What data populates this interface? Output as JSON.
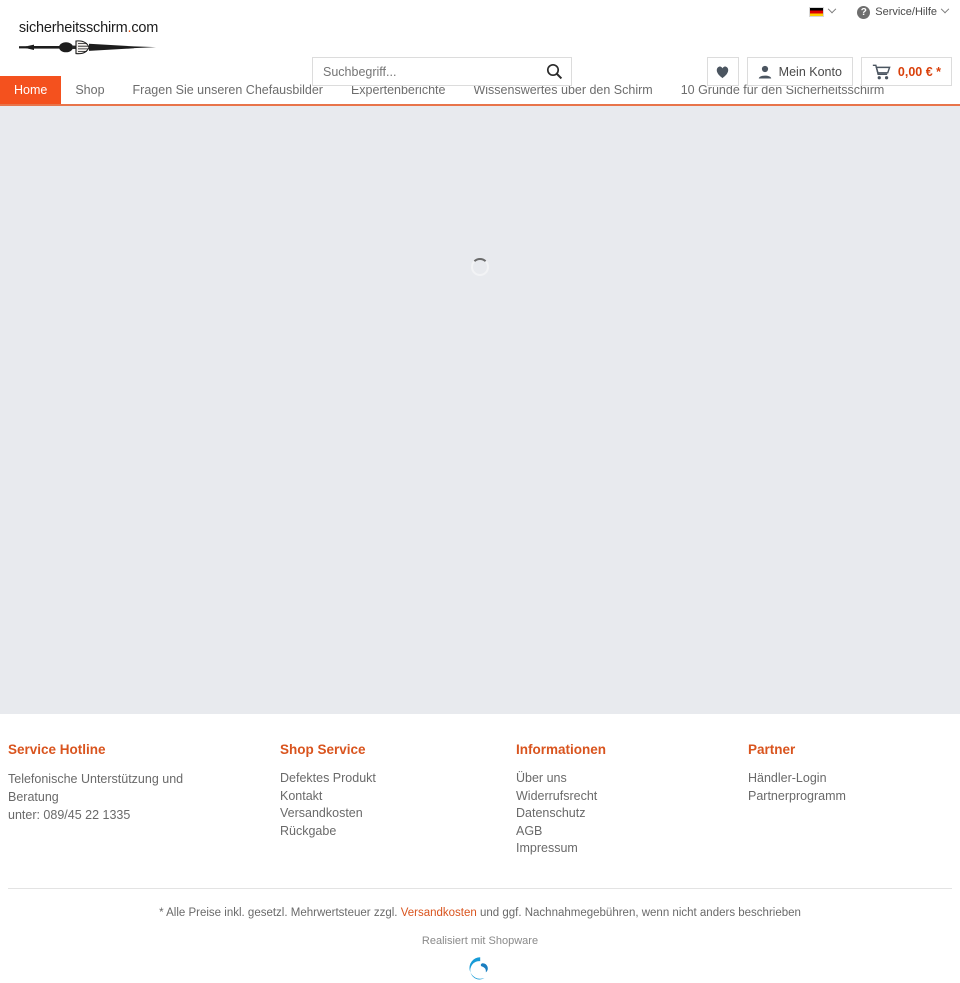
{
  "topbar": {
    "language": {
      "icon": "german-flag-icon",
      "label": "",
      "chevron": "chevron-down-icon"
    },
    "service": {
      "icon": "question-circle-icon",
      "label": "Service/Hilfe",
      "chevron": "chevron-down-icon"
    }
  },
  "header": {
    "logo": {
      "text": "sicherheitsschirm",
      "dot": ".",
      "tld": "com",
      "art": "umbrella-fist-icon"
    },
    "search": {
      "placeholder": "Suchbegriff...",
      "value": "",
      "button_icon": "search-icon"
    },
    "actions": {
      "wishlist": {
        "icon": "heart-icon",
        "label": ""
      },
      "account": {
        "icon": "user-icon",
        "label": "Mein Konto"
      },
      "cart": {
        "icon": "cart-icon",
        "label": "0,00 € *"
      }
    }
  },
  "nav": {
    "items": [
      {
        "label": "Home",
        "active": true
      },
      {
        "label": "Shop",
        "active": false
      },
      {
        "label": "Fragen Sie unseren Chefausbilder",
        "active": false
      },
      {
        "label": "Expertenberichte",
        "active": false
      },
      {
        "label": "Wissenswertes über den Schirm",
        "active": false
      },
      {
        "label": "10 Gründe für den Sicherheitsschirm",
        "active": false
      }
    ]
  },
  "content": {
    "state": "loading",
    "spinner": "loading-spinner"
  },
  "footer": {
    "columns": [
      {
        "title": "Service Hotline",
        "type": "text",
        "lines": [
          "Telefonische Unterstützung und Beratung",
          "unter: 089/45 22 1335"
        ]
      },
      {
        "title": "Shop Service",
        "type": "links",
        "links": [
          "Defektes Produkt",
          "Kontakt",
          "Versandkosten",
          "Rückgabe"
        ]
      },
      {
        "title": "Informationen",
        "type": "links",
        "links": [
          "Über uns",
          "Widerrufsrecht",
          "Datenschutz",
          "AGB",
          "Impressum"
        ]
      },
      {
        "title": "Partner",
        "type": "links",
        "links": [
          "Händler-Login",
          "Partnerprogramm"
        ]
      }
    ],
    "legal": {
      "before": "* Alle Preise inkl. gesetzl. Mehrwertsteuer zzgl. ",
      "link": "Versandkosten",
      "after": " und ggf. Nachnahmegebühren, wenn nicht anders beschrieben"
    },
    "powered_by": "Realisiert mit Shopware",
    "shopware_logo": "shopware-logo-icon"
  },
  "colors": {
    "accent_orange": "#f4511e",
    "link_orange": "#d9541e",
    "cart_orange": "#d9400b",
    "content_bg": "#e8eaee",
    "shopware_blue": "#179bd7"
  }
}
